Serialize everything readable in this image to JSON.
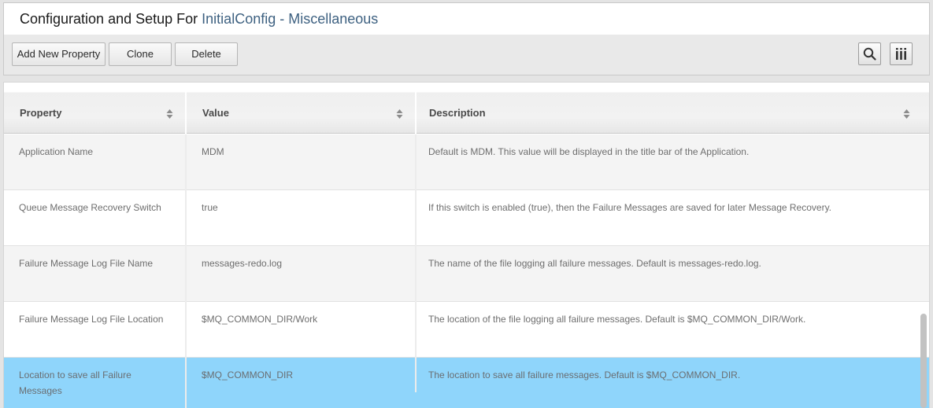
{
  "header": {
    "title_prefix": "Configuration and Setup For",
    "config_name": "InitialConfig",
    "section": "- Miscellaneous"
  },
  "toolbar": {
    "add_label": "Add New Property",
    "clone_label": "Clone",
    "delete_label": "Delete",
    "search_icon": "search-icon",
    "columns_icon": "columns-icon"
  },
  "table": {
    "columns": [
      "Property",
      "Value",
      "Description"
    ],
    "rows": [
      {
        "property": "Application Name",
        "value": "MDM",
        "description": "Default is MDM. This value will be displayed in the title bar of the Application."
      },
      {
        "property": "Queue Message Recovery Switch",
        "value": "true",
        "description": "If this switch is enabled (true), then the Failure Messages are saved for later Message Recovery."
      },
      {
        "property": "Failure Message Log File Name",
        "value": "messages-redo.log",
        "description": "The name of the file logging all failure messages. Default is messages-redo.log."
      },
      {
        "property": "Failure Message Log File Location",
        "value": "$MQ_COMMON_DIR/Work",
        "description": "The location of the file logging all failure messages. Default is $MQ_COMMON_DIR/Work."
      },
      {
        "property": "Location to save all Failure Messages",
        "value": "$MQ_COMMON_DIR",
        "description": "The location to save all failure messages. Default is $MQ_COMMON_DIR.",
        "selected": true
      }
    ]
  },
  "colors": {
    "title_accent": "#3e6181",
    "selected_row": "#8fd5fb"
  }
}
